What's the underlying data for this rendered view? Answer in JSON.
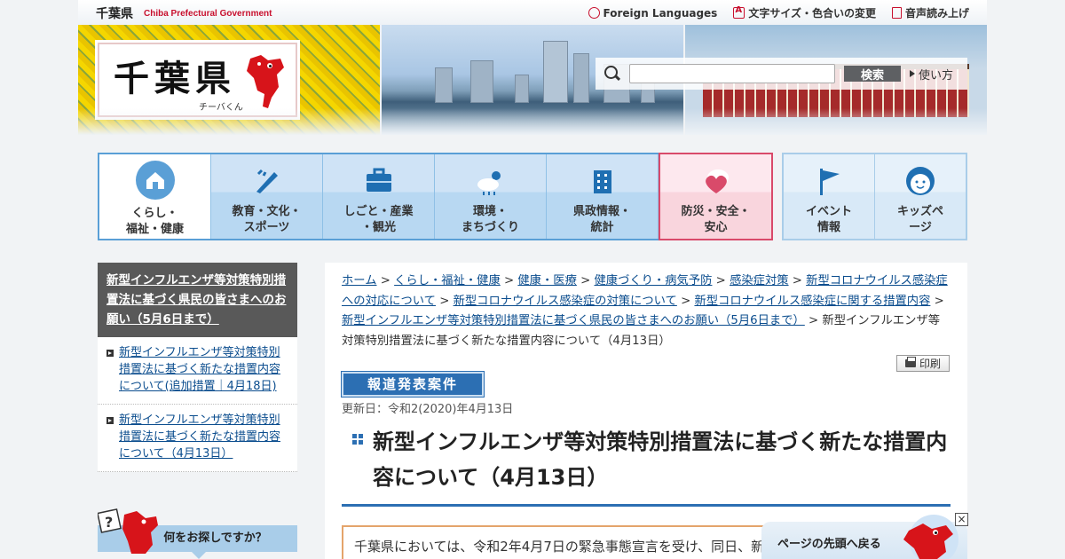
{
  "header": {
    "pref_name": "千葉県",
    "pref_name_en": "Chiba Prefectural Government",
    "utility": [
      {
        "label": "Foreign Languages",
        "icon": "globe-icon"
      },
      {
        "label": "文字サイズ・色合いの変更",
        "icon": "text-size-icon"
      },
      {
        "label": "音声読み上げ",
        "icon": "speaker-icon"
      }
    ],
    "logo_text": "千葉県",
    "logo_sub": "チーバくん",
    "search": {
      "placeholder": "",
      "button": "検索",
      "usage": "使い方"
    }
  },
  "global_nav": [
    {
      "label": "くらし・\n福祉・健康",
      "icon": "house-icon"
    },
    {
      "label": "教育・文化・\nスポーツ",
      "icon": "pen-icon"
    },
    {
      "label": "しごと・産業\n・観光",
      "icon": "briefcase-icon"
    },
    {
      "label": "環境・\nまちづくり",
      "icon": "weather-icon"
    },
    {
      "label": "県政情報・\n統計",
      "icon": "building-icon"
    },
    {
      "label": "防災・安全・\n安心",
      "icon": "heart-icon"
    }
  ],
  "sub_nav": [
    {
      "label": "イベント\n情報",
      "icon": "flag-icon"
    },
    {
      "label": "キッズペ\nージ",
      "icon": "kid-face-icon"
    }
  ],
  "sidebar": {
    "heading": "新型インフルエンザ等対策特別措置法に基づく県民の皆さまへのお願い（5月6日まで）",
    "items": [
      "新型インフルエンザ等対策特別措置法に基づく新たな措置内容について(追加措置｜4月18日)",
      "新型インフルエンザ等対策特別措置法に基づく新たな措置内容について（4月13日）"
    ],
    "search_prompt": "何をお探しですか？"
  },
  "breadcrumb": {
    "links": [
      "ホーム",
      "くらし・福祉・健康",
      "健康・医療",
      "健康づくり・病気予防",
      "感染症対策",
      "新型コロナウイルス感染症への対応について",
      "新型コロナウイルス感染症の対策について",
      "新型コロナウイルス感染症に関する措置内容",
      "新型インフルエンザ等対策特別措置法に基づく県民の皆さまへのお願い（5月6日まで）"
    ],
    "current": "新型インフルエンザ等対策特別措置法に基づく新たな措置内容について（4月13日）",
    "separator": " > "
  },
  "main": {
    "print_label": "印刷",
    "press_badge": "報道発表案件",
    "updated": "更新日：令和2(2020)年4月13日",
    "title": "新型インフルエンザ等対策特別措置法に基づく新たな措置内容について（4月13日）",
    "body_first_line": "千葉県においては、令和2年4月7日の緊急事態宣言を受け、同日、新型インフルエンザ等"
  },
  "page_top": {
    "label": "ページの先頭へ戻る",
    "close": "×"
  },
  "colors": {
    "accent": "#2c6fb3",
    "nav_bg": "#b8d8f2",
    "alert": "#d94a6a",
    "brand_red": "#c8102e"
  }
}
